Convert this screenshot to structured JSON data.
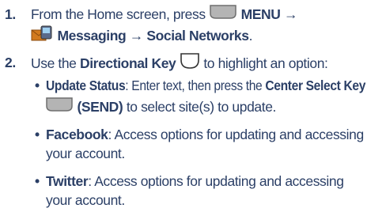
{
  "steps": [
    {
      "number": "1.",
      "line1": {
        "pre": "From the Home screen, press",
        "menu": "MENU",
        "arrow": "→"
      },
      "line2": {
        "messaging": "Messaging",
        "arrow": "→",
        "social": "Social Networks",
        "end": "."
      }
    },
    {
      "number": "2.",
      "line1": {
        "pre": "Use the ",
        "dir_key": "Directional Key",
        "post": " to highlight an option:"
      }
    }
  ],
  "options": [
    {
      "name": "Update Status",
      "sep": ": ",
      "text1": "Enter text, then press the ",
      "key_name": "Center Select Key",
      "send": "(SEND)",
      "text2": " to select site(s) to update."
    },
    {
      "name": "Facebook",
      "sep": ": ",
      "text1": "Access options for updating and accessing",
      "text2": "your account."
    },
    {
      "name": "Twitter",
      "sep": ": ",
      "text1": "Access options for updating and accessing",
      "text2": "your account."
    }
  ],
  "bullet": "•",
  "colors": {
    "text": "#2b3f66",
    "key_fill": "#b4b4b4",
    "key_stroke": "#6e6e6e"
  }
}
